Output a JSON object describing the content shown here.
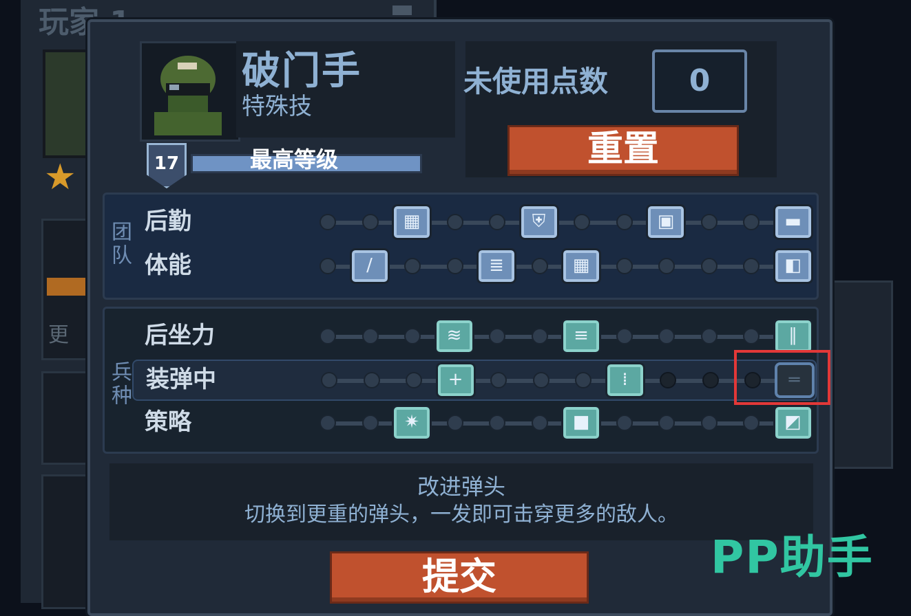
{
  "background": {
    "player_title": "玩家 1",
    "bg_text": "更"
  },
  "header": {
    "class_name": "破门手",
    "class_sub": "特殊技",
    "level": "17",
    "level_status": "最高等级",
    "unused_points_label": "未使用点数",
    "unused_points_value": "0",
    "reset_label": "重置"
  },
  "sections": [
    {
      "label": "团队",
      "rows": [
        {
          "label": "后勤",
          "perks_at": [
            2,
            5,
            8,
            11
          ],
          "icons": [
            "ammo-crate-icon",
            "medkit-shield-icon",
            "battery-icon",
            "supply-pack-icon"
          ]
        },
        {
          "label": "体能",
          "perks_at": [
            1,
            4,
            6,
            11
          ],
          "icons": [
            "knife-icon",
            "sprint-icon",
            "armor-plates-icon",
            "sneak-icon"
          ]
        }
      ]
    },
    {
      "label": "兵种",
      "rows": [
        {
          "label": "后坐力",
          "perks_at": [
            3,
            6,
            11
          ],
          "icons": [
            "grip-icon",
            "stabilizer-icon",
            "barrel-icon"
          ]
        },
        {
          "label": "装弹中",
          "perks_at": [
            3,
            7,
            11
          ],
          "icons": [
            "extra-shell-icon",
            "speed-loader-icon",
            "heavy-slug-icon"
          ],
          "selected": 11
        },
        {
          "label": "策略",
          "perks_at": [
            2,
            6,
            11
          ],
          "icons": [
            "explosive-icon",
            "armor-lock-icon",
            "shield-tactic-icon"
          ]
        }
      ]
    }
  ],
  "description": {
    "title": "改进弹头",
    "text": "切换到更重的弹头，一发即可击穿更多的敌人。"
  },
  "submit_label": "提交",
  "watermark": "PP助手",
  "colors": {
    "accent": "#c0512e",
    "team_perk": "#6e8fb8",
    "spec_perk": "#5ca8a2",
    "selection_outline": "#e23838",
    "watermark": "#31c6a2"
  }
}
